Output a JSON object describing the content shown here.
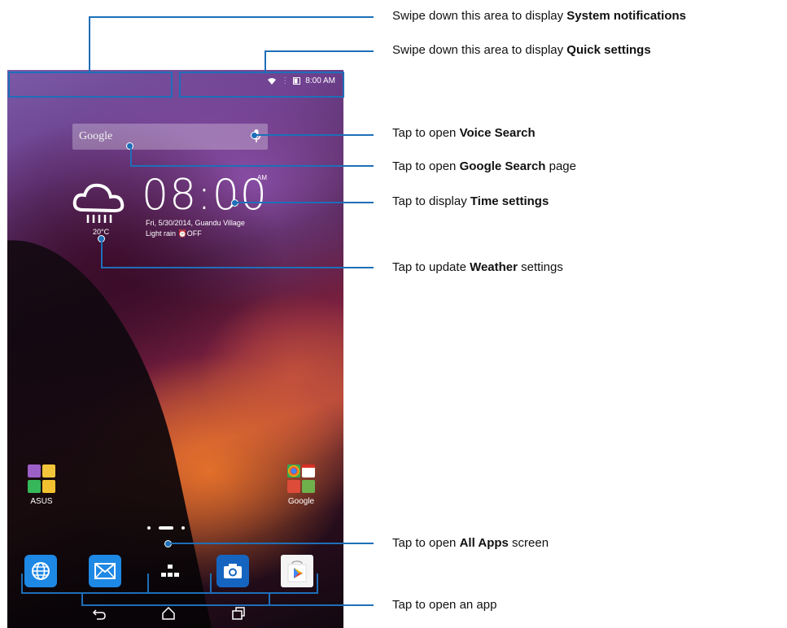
{
  "status_bar": {
    "time": "8:00 AM"
  },
  "search": {
    "label": "Google"
  },
  "clock": {
    "time": "08:00",
    "ampm": "AM",
    "date": "Fri, 5/30/2014, Guandu Village",
    "weather_text": "Light rain",
    "alarm": "OFF"
  },
  "weather": {
    "temperature": "20°C"
  },
  "folders": {
    "left_name": "ASUS",
    "right_name": "Google"
  },
  "callouts": [
    {
      "prefix": "Swipe down this area to display ",
      "bold": "System notifications",
      "suffix": ""
    },
    {
      "prefix": "Swipe down this area to display ",
      "bold": "Quick settings",
      "suffix": ""
    },
    {
      "prefix": "Tap to open ",
      "bold": "Voice Search",
      "suffix": ""
    },
    {
      "prefix": "Tap to open ",
      "bold": "Google Search",
      "suffix": " page"
    },
    {
      "prefix": "Tap to display ",
      "bold": "Time settings",
      "suffix": ""
    },
    {
      "prefix": "Tap to update ",
      "bold": "Weather",
      "suffix": " settings"
    },
    {
      "prefix": "Tap to open ",
      "bold": "All Apps",
      "suffix": " screen"
    },
    {
      "prefix": "Tap to open an app",
      "bold": "",
      "suffix": ""
    }
  ],
  "colors": {
    "callout": "#1e6fb8",
    "browser": "#1e88e5",
    "email": "#1e88e5",
    "camera": "#1565c0"
  },
  "icons": [
    "wifi-icon",
    "battery-icon",
    "mic-icon",
    "cloud-rain-icon",
    "browser-icon",
    "email-icon",
    "all-apps-icon",
    "camera-icon",
    "play-store-icon",
    "back-icon",
    "home-icon",
    "recent-apps-icon"
  ]
}
